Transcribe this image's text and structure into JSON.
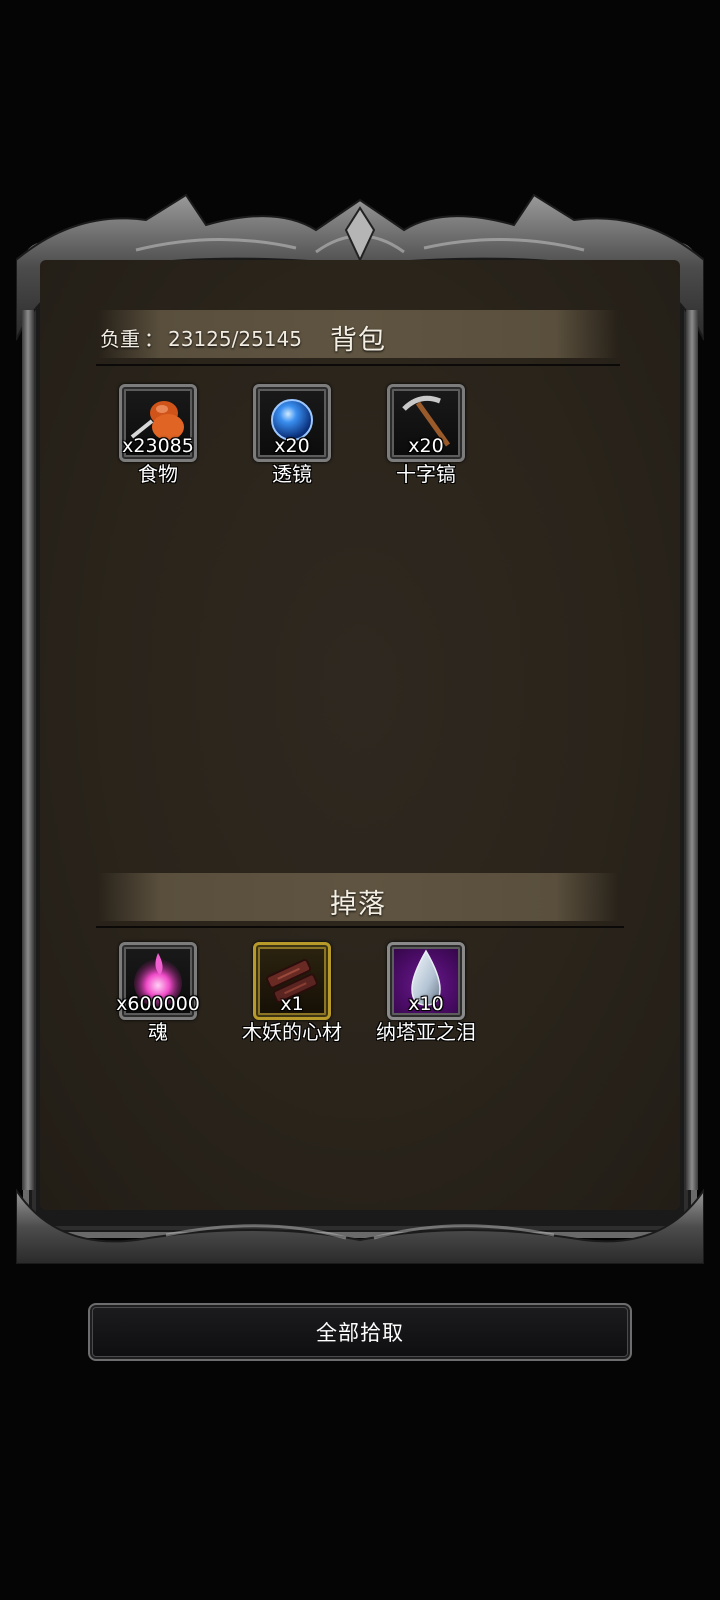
{
  "backpack": {
    "title": "背包",
    "weight_label": "负重",
    "weight_sep": "：",
    "weight_value": "23125/25145",
    "items": [
      {
        "name": "食物",
        "qty": "x23085",
        "icon": "meat-icon"
      },
      {
        "name": "透镜",
        "qty": "x20",
        "icon": "blue-orb-icon"
      },
      {
        "name": "十字镐",
        "qty": "x20",
        "icon": "pickaxe-icon"
      }
    ]
  },
  "drops": {
    "title": "掉落",
    "items": [
      {
        "name": "魂",
        "qty": "x600000",
        "icon": "pink-soul-icon"
      },
      {
        "name": "木妖的心材",
        "qty": "x1",
        "icon": "heartwood-icon"
      },
      {
        "name": "纳塔亚之泪",
        "qty": "x10",
        "icon": "teardrop-icon"
      }
    ]
  },
  "pickup_all_label": "全部拾取",
  "colors": {
    "panel": "#2a241b",
    "section_bar": "#5f5441",
    "frame_metal": "#8a8a8a",
    "gold_border": "#b89a2a",
    "purple_bg": "#4a0c66"
  }
}
